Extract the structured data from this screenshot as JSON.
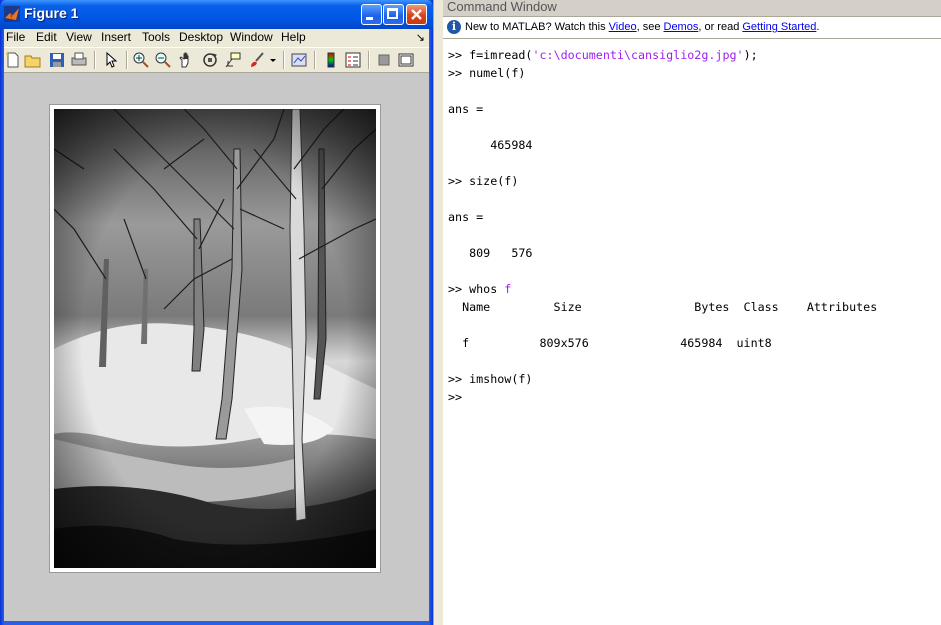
{
  "figure_window": {
    "title": "Figure 1",
    "menu": [
      "File",
      "Edit",
      "View",
      "Insert",
      "Tools",
      "Desktop",
      "Window",
      "Help"
    ],
    "dock_glyph": "↘",
    "toolbar_icons": [
      "new-figure-icon",
      "open-file-icon",
      "save-icon",
      "print-icon",
      "edit-plot-icon",
      "zoom-in-icon",
      "zoom-out-icon",
      "pan-icon",
      "rotate-3d-icon",
      "data-cursor-icon",
      "brush-icon",
      "brush-dropdown-icon",
      "link-plot-icon",
      "colorbar-icon",
      "legend-icon",
      "hide-plot-tools-icon",
      "show-plot-tools-icon"
    ]
  },
  "command_window": {
    "title": "Command Window",
    "info": {
      "prefix": "New to MATLAB? Watch this ",
      "link_video": "Video",
      "mid1": ", see ",
      "link_demos": "Demos",
      "mid2": ", or read ",
      "link_getting_started": "Getting Started",
      "suffix": "."
    },
    "lines": {
      "l1_prompt": ">> f=imread(",
      "l1_string": "'c:\\documenti\\cansiglio2g.jpg'",
      "l1_end": ");",
      "l2": ">> numel(f)",
      "l3": "",
      "l4": "ans =",
      "l5": "",
      "l6": "      465984",
      "l7": "",
      "l8": ">> size(f)",
      "l9": "",
      "l10": "ans =",
      "l11": "",
      "l12": "   809   576",
      "l13": "",
      "l14_prompt": ">> whos ",
      "l14_arg": "f",
      "l15": "  Name         Size                Bytes  Class    Attributes",
      "l16": "",
      "l17": "  f          809x576             465984  uint8",
      "l18": "",
      "l19": ">> imshow(f)",
      "l20": ">>"
    }
  }
}
